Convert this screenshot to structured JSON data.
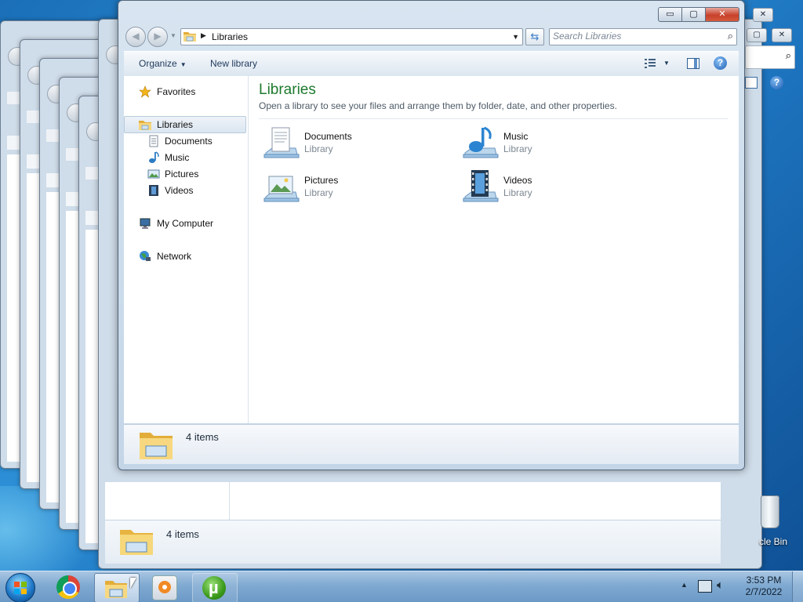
{
  "window": {
    "title": "Libraries",
    "caption": {
      "minimize": "▭",
      "maximize": "▢",
      "close": "✕"
    }
  },
  "address": {
    "crumb": "Libraries",
    "search_placeholder": "Search Libraries"
  },
  "toolbar": {
    "organize_label": "Organize",
    "new_library_label": "New library"
  },
  "sidebar": {
    "favorites": "Favorites",
    "libraries": "Libraries",
    "library_items": [
      "Documents",
      "Music",
      "Pictures",
      "Videos"
    ],
    "my_computer": "My Computer",
    "network": "Network"
  },
  "content": {
    "title": "Libraries",
    "description": "Open a library to see your files and arrange them by folder, date, and other properties.",
    "libraries": [
      {
        "name": "Documents",
        "type": "Library",
        "icon": "documents-library-icon"
      },
      {
        "name": "Music",
        "type": "Library",
        "icon": "music-library-icon"
      },
      {
        "name": "Pictures",
        "type": "Library",
        "icon": "pictures-library-icon"
      },
      {
        "name": "Videos",
        "type": "Library",
        "icon": "videos-library-icon"
      }
    ]
  },
  "details": {
    "count": "4 items"
  },
  "background_window": {
    "count": "4 items"
  },
  "desktop": {
    "recycle_bin_label": "cle Bin"
  },
  "taskbar": {
    "apps": [
      "chrome-icon",
      "explorer-icon",
      "media-player-icon",
      "utorrent-icon"
    ],
    "clock": {
      "time": "3:53 PM",
      "date": "2/7/2022"
    }
  },
  "colors": {
    "accent_title": "#1e7a2e",
    "close_button": "#c7412b",
    "taskbar": "#7fa9d1"
  }
}
